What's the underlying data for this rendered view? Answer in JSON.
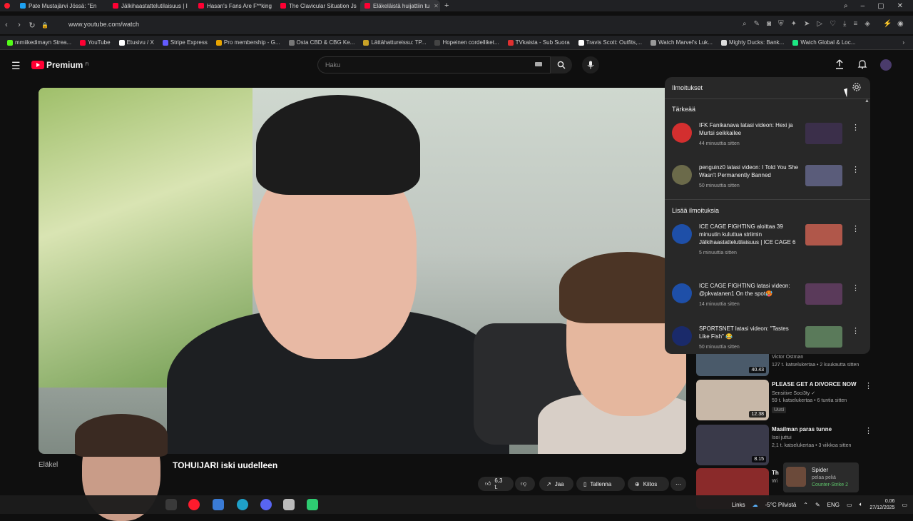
{
  "browser": {
    "tabs": [
      {
        "label": "Pate Mustajärvi Jössä: \"En",
        "color": "#1da1f2"
      },
      {
        "label": "Jälkihaastattelutilaisuus | I",
        "color": "#ff0033"
      },
      {
        "label": "Hasan's Fans Are F**king",
        "color": "#ff0033"
      },
      {
        "label": "The Clavicular Situation Js",
        "color": "#ff0033"
      },
      {
        "label": "Eläkeläistä huijattiin tu",
        "color": "#ff0033",
        "active": true
      }
    ],
    "url": "www.youtube.com/watch",
    "bookmarks": [
      {
        "label": "mmiikedimayn Strea...",
        "color": "#53fc18"
      },
      {
        "label": "YouTube",
        "color": "#ff0033"
      },
      {
        "label": "Etusivu / X",
        "color": "#ffffff"
      },
      {
        "label": "Stripe Express",
        "color": "#635bff"
      },
      {
        "label": "Pro membership - G...",
        "color": "#e8a400"
      },
      {
        "label": "Osta CBD & CBG Ke...",
        "color": "#777777"
      },
      {
        "label": "Lättähattureissu: TP...",
        "color": "#c9a227"
      },
      {
        "label": "Hopeinen cordelliket...",
        "color": "#444444"
      },
      {
        "label": "TVkaista - Sub Suora",
        "color": "#e03030"
      },
      {
        "label": "Travis Scott: Outfits,...",
        "color": "#ffffff"
      },
      {
        "label": "Watch Marvel's Luk...",
        "color": "#999999"
      },
      {
        "label": "Mighty Ducks: Bank...",
        "color": "#dddddd"
      },
      {
        "label": "Watch Global & Loc...",
        "color": "#1ce783"
      }
    ]
  },
  "youtube": {
    "logo": "Premium",
    "logo_sup": "FI",
    "search_placeholder": "Haku",
    "video_title": "TOHUIJARI iski uudelleen",
    "channel_partial": "Eläkel",
    "actions": {
      "like": "6,3 t.",
      "share": "Jaa",
      "save": "Tallenna",
      "thanks": "Kiitos",
      "more": "⋯"
    }
  },
  "notifications": {
    "title": "Ilmoitukset",
    "section_important": "Tärkeää",
    "section_more": "Lisää ilmoituksia",
    "important": [
      {
        "text": "IFK Fanikanava latasi videon: Hexi ja Murtsi seikkailee",
        "time": "44 minuuttia sitten",
        "avatar": "#d32f2f",
        "thumb": "#3b2f4a"
      },
      {
        "text": "penguinz0 latasi videon: I Told You She Wasn't Permanently Banned",
        "time": "50 minuuttia sitten",
        "avatar": "#6b6a4a",
        "thumb": "#5a5c7a"
      }
    ],
    "more": [
      {
        "text": "ICE CAGE FIGHTING aloittaa 39 minuutin kuluttua striimin Jälkihaastattelutilaisuus | ICE CAGE 6",
        "time": "5 minuuttia sitten",
        "avatar": "#1e4fa8",
        "thumb": "#b0574a"
      },
      {
        "text": "ICE CAGE FIGHTING latasi videon: @pkvatanen1 On the spot🥵",
        "time": "14 minuuttia sitten",
        "avatar": "#1e4fa8",
        "thumb": "#5a3a5a"
      },
      {
        "text": "SPORTSNET latasi videon: \"Tastes Like Fish\" 😂",
        "time": "50 minuuttia sitten",
        "avatar": "#1a2a6a",
        "thumb": "#5a7a5a"
      }
    ]
  },
  "recommendations": [
    {
      "title": "",
      "channel": "Victor Ostman",
      "meta": "127 t. katselukertaa • 2 kuukautta sitten",
      "duration": "40.43",
      "thumb": "#4a5a6a",
      "badge": ""
    },
    {
      "title": "PLEASE GET A DIVORCE NOW",
      "channel": "Sensitive Soci3ty ✓",
      "meta": "59 t. katselukertaa • 6 tuntia sitten",
      "duration": "12.38",
      "thumb": "#c8b8a8",
      "badge": "Uusi"
    },
    {
      "title": "Maailman paras tunne",
      "channel": "Isoi juttui",
      "meta": "2,1 t. katselukertaa • 3 viikkoa sitten",
      "duration": "8.15",
      "thumb": "#3a3a4a",
      "badge": ""
    },
    {
      "title": "Th",
      "channel": "Wi",
      "meta": "",
      "duration": "",
      "thumb": "#8a2a2a",
      "badge": ""
    }
  ],
  "activity": {
    "name": "Spider",
    "status": "pelaa peliä",
    "game": "Counter-Strike 2"
  },
  "taskbar": {
    "links_label": "Links",
    "weather": "-5°C Pilvistä",
    "lang": "ENG",
    "time": "0.06",
    "date": "27/12/2025"
  }
}
